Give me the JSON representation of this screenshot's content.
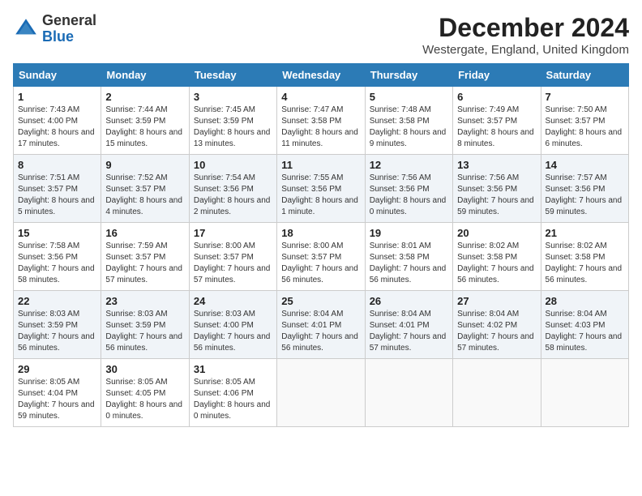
{
  "header": {
    "logo_line1": "General",
    "logo_line2": "Blue",
    "month": "December 2024",
    "location": "Westergate, England, United Kingdom"
  },
  "days_of_week": [
    "Sunday",
    "Monday",
    "Tuesday",
    "Wednesday",
    "Thursday",
    "Friday",
    "Saturday"
  ],
  "weeks": [
    [
      {
        "day": "1",
        "sunrise": "7:43 AM",
        "sunset": "4:00 PM",
        "daylight": "8 hours and 17 minutes."
      },
      {
        "day": "2",
        "sunrise": "7:44 AM",
        "sunset": "3:59 PM",
        "daylight": "8 hours and 15 minutes."
      },
      {
        "day": "3",
        "sunrise": "7:45 AM",
        "sunset": "3:59 PM",
        "daylight": "8 hours and 13 minutes."
      },
      {
        "day": "4",
        "sunrise": "7:47 AM",
        "sunset": "3:58 PM",
        "daylight": "8 hours and 11 minutes."
      },
      {
        "day": "5",
        "sunrise": "7:48 AM",
        "sunset": "3:58 PM",
        "daylight": "8 hours and 9 minutes."
      },
      {
        "day": "6",
        "sunrise": "7:49 AM",
        "sunset": "3:57 PM",
        "daylight": "8 hours and 8 minutes."
      },
      {
        "day": "7",
        "sunrise": "7:50 AM",
        "sunset": "3:57 PM",
        "daylight": "8 hours and 6 minutes."
      }
    ],
    [
      {
        "day": "8",
        "sunrise": "7:51 AM",
        "sunset": "3:57 PM",
        "daylight": "8 hours and 5 minutes."
      },
      {
        "day": "9",
        "sunrise": "7:52 AM",
        "sunset": "3:57 PM",
        "daylight": "8 hours and 4 minutes."
      },
      {
        "day": "10",
        "sunrise": "7:54 AM",
        "sunset": "3:56 PM",
        "daylight": "8 hours and 2 minutes."
      },
      {
        "day": "11",
        "sunrise": "7:55 AM",
        "sunset": "3:56 PM",
        "daylight": "8 hours and 1 minute."
      },
      {
        "day": "12",
        "sunrise": "7:56 AM",
        "sunset": "3:56 PM",
        "daylight": "8 hours and 0 minutes."
      },
      {
        "day": "13",
        "sunrise": "7:56 AM",
        "sunset": "3:56 PM",
        "daylight": "7 hours and 59 minutes."
      },
      {
        "day": "14",
        "sunrise": "7:57 AM",
        "sunset": "3:56 PM",
        "daylight": "7 hours and 59 minutes."
      }
    ],
    [
      {
        "day": "15",
        "sunrise": "7:58 AM",
        "sunset": "3:56 PM",
        "daylight": "7 hours and 58 minutes."
      },
      {
        "day": "16",
        "sunrise": "7:59 AM",
        "sunset": "3:57 PM",
        "daylight": "7 hours and 57 minutes."
      },
      {
        "day": "17",
        "sunrise": "8:00 AM",
        "sunset": "3:57 PM",
        "daylight": "7 hours and 57 minutes."
      },
      {
        "day": "18",
        "sunrise": "8:00 AM",
        "sunset": "3:57 PM",
        "daylight": "7 hours and 56 minutes."
      },
      {
        "day": "19",
        "sunrise": "8:01 AM",
        "sunset": "3:58 PM",
        "daylight": "7 hours and 56 minutes."
      },
      {
        "day": "20",
        "sunrise": "8:02 AM",
        "sunset": "3:58 PM",
        "daylight": "7 hours and 56 minutes."
      },
      {
        "day": "21",
        "sunrise": "8:02 AM",
        "sunset": "3:58 PM",
        "daylight": "7 hours and 56 minutes."
      }
    ],
    [
      {
        "day": "22",
        "sunrise": "8:03 AM",
        "sunset": "3:59 PM",
        "daylight": "7 hours and 56 minutes."
      },
      {
        "day": "23",
        "sunrise": "8:03 AM",
        "sunset": "3:59 PM",
        "daylight": "7 hours and 56 minutes."
      },
      {
        "day": "24",
        "sunrise": "8:03 AM",
        "sunset": "4:00 PM",
        "daylight": "7 hours and 56 minutes."
      },
      {
        "day": "25",
        "sunrise": "8:04 AM",
        "sunset": "4:01 PM",
        "daylight": "7 hours and 56 minutes."
      },
      {
        "day": "26",
        "sunrise": "8:04 AM",
        "sunset": "4:01 PM",
        "daylight": "7 hours and 57 minutes."
      },
      {
        "day": "27",
        "sunrise": "8:04 AM",
        "sunset": "4:02 PM",
        "daylight": "7 hours and 57 minutes."
      },
      {
        "day": "28",
        "sunrise": "8:04 AM",
        "sunset": "4:03 PM",
        "daylight": "7 hours and 58 minutes."
      }
    ],
    [
      {
        "day": "29",
        "sunrise": "8:05 AM",
        "sunset": "4:04 PM",
        "daylight": "7 hours and 59 minutes."
      },
      {
        "day": "30",
        "sunrise": "8:05 AM",
        "sunset": "4:05 PM",
        "daylight": "8 hours and 0 minutes."
      },
      {
        "day": "31",
        "sunrise": "8:05 AM",
        "sunset": "4:06 PM",
        "daylight": "8 hours and 0 minutes."
      },
      null,
      null,
      null,
      null
    ]
  ],
  "labels": {
    "sunrise": "Sunrise:",
    "sunset": "Sunset:",
    "daylight": "Daylight:"
  }
}
